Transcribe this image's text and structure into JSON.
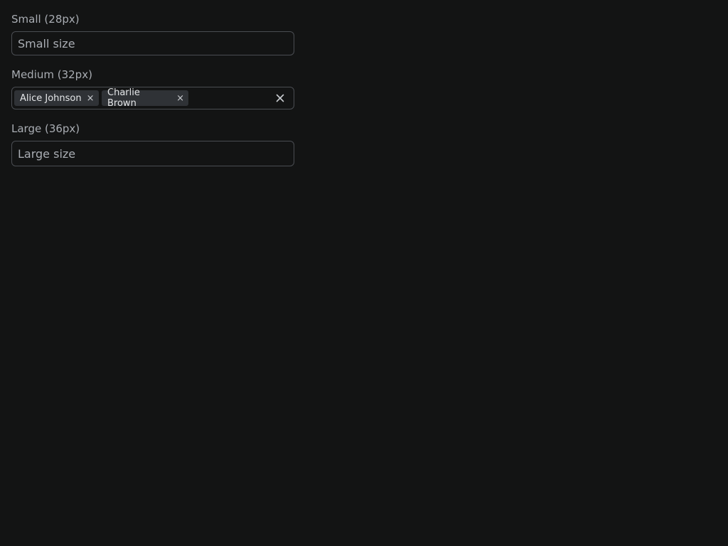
{
  "fields": {
    "small": {
      "label": "Small (28px)",
      "placeholder": "Small size"
    },
    "medium": {
      "label": "Medium (32px)",
      "tags": [
        {
          "label": "Alice Johnson",
          "remove_icon": "close-icon"
        },
        {
          "label": "Charlie Brown",
          "remove_icon": "close-icon"
        }
      ],
      "clear_icon": "close-icon"
    },
    "large": {
      "label": "Large (36px)",
      "placeholder": "Large size"
    }
  },
  "colors": {
    "background": "#131414",
    "border": "#4a4d52",
    "tag_background": "#2f3236",
    "text": "#a9adb3",
    "tag_text": "#e4e6e8"
  }
}
